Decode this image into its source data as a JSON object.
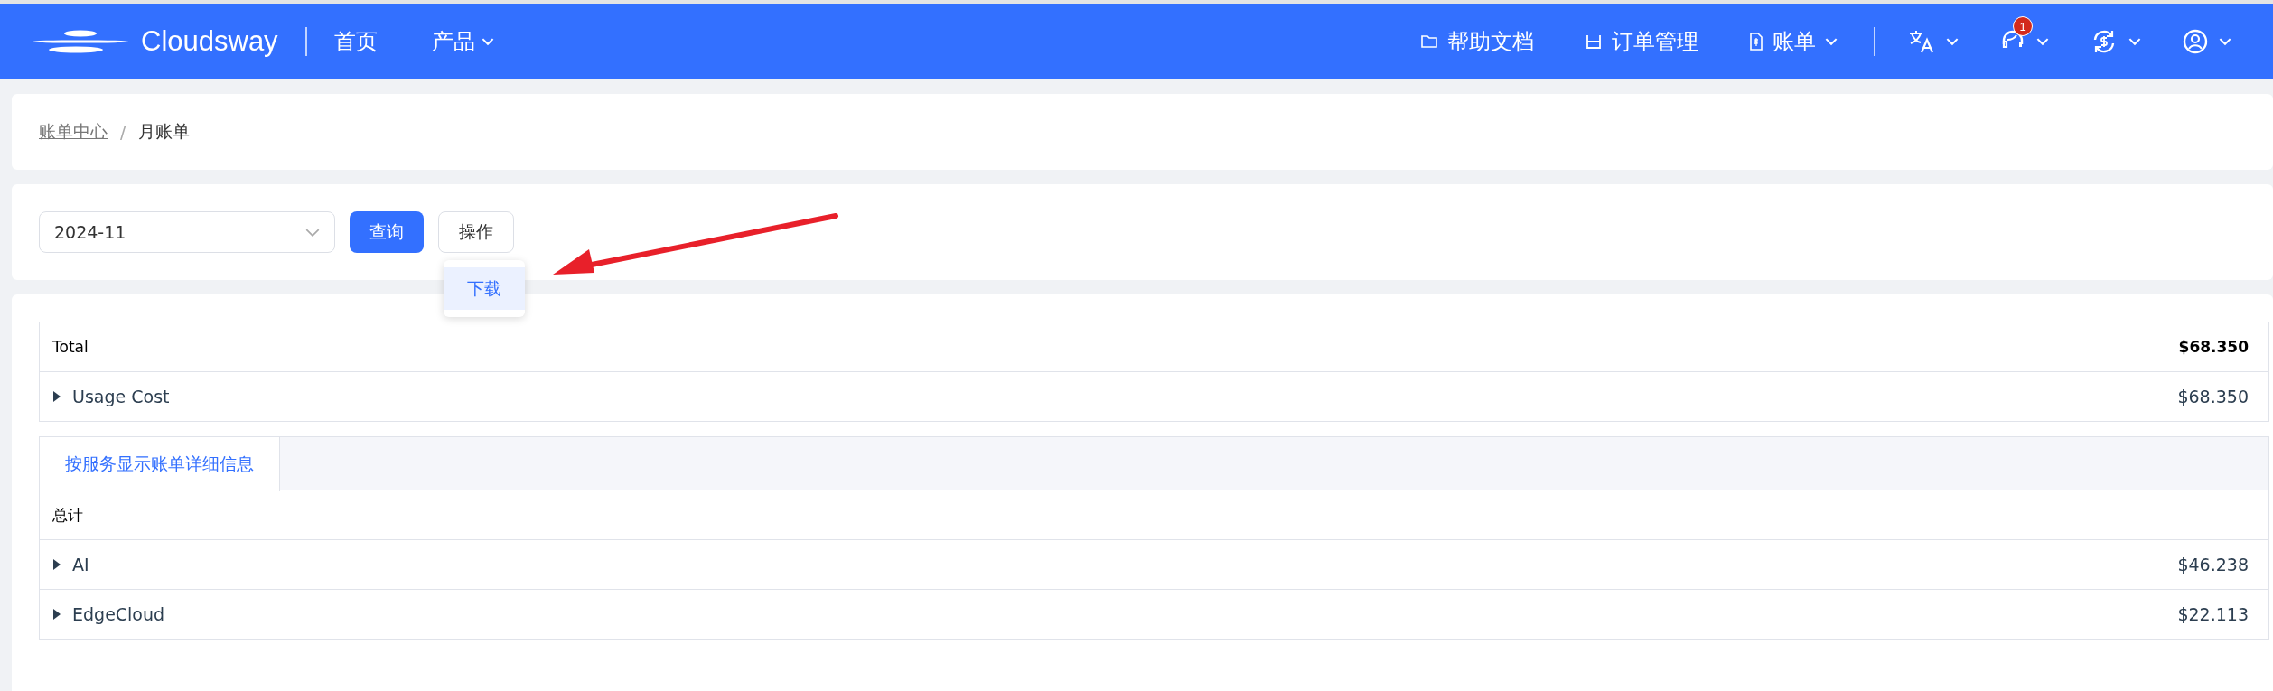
{
  "header": {
    "logo": "Cloudsway",
    "nav": [
      {
        "label": "首页",
        "dropdown": false
      },
      {
        "label": "产品",
        "dropdown": true
      }
    ],
    "links": [
      {
        "label": "帮助文档",
        "kind": "folder",
        "dropdown": false
      },
      {
        "label": "订单管理",
        "kind": "order",
        "dropdown": false
      },
      {
        "label": "账单",
        "kind": "bill",
        "dropdown": true
      }
    ],
    "tools": [
      {
        "kind": "translate"
      },
      {
        "kind": "support",
        "badge": "1"
      },
      {
        "kind": "currency"
      },
      {
        "kind": "user"
      }
    ]
  },
  "breadcrumb": {
    "separator": "/",
    "items": [
      {
        "label": "账单中心",
        "link": true
      },
      {
        "label": "月账单",
        "link": false
      }
    ]
  },
  "filter": {
    "month": "2024-11",
    "query_button": "查询",
    "action_button": "操作",
    "menu": [
      {
        "label": "下载",
        "selected": true
      }
    ]
  },
  "summary": [
    {
      "kind": "total",
      "label": "Total",
      "amount": "$68.350"
    },
    {
      "kind": "group",
      "label": "Usage Cost",
      "amount": "$68.350",
      "expanded": false
    }
  ],
  "detail": {
    "tabs": [
      {
        "label": "按服务显示账单详细信息",
        "selected": true
      }
    ],
    "rows": [
      {
        "kind": "total",
        "label": "总计"
      },
      {
        "kind": "group",
        "label": "AI",
        "amount": "$46.238",
        "expanded": false
      },
      {
        "kind": "group",
        "label": "EdgeCloud",
        "amount": "$22.113",
        "expanded": false
      }
    ]
  }
}
